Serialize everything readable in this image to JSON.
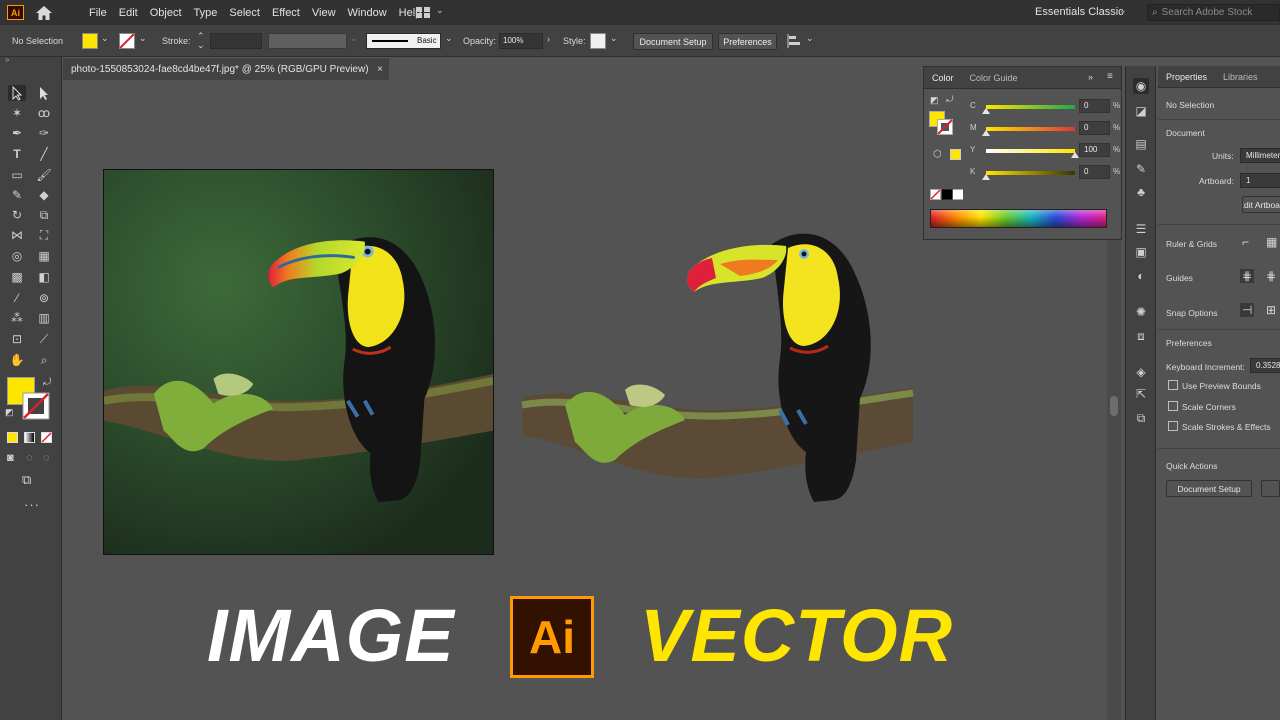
{
  "app": {
    "logo": "Ai"
  },
  "menu": [
    "File",
    "Edit",
    "Object",
    "Type",
    "Select",
    "Effect",
    "View",
    "Window",
    "Help"
  ],
  "workspace": "Essentials Classic",
  "search": {
    "placeholder": "Search Adobe Stock"
  },
  "controlbar": {
    "selection": "No Selection",
    "stroke_label": "Stroke:",
    "brush": "Basic",
    "opacity_label": "Opacity:",
    "opacity_value": "100%",
    "style_label": "Style:",
    "document_setup": "Document Setup",
    "preferences": "Preferences"
  },
  "document_tab": {
    "title": "photo-1550853024-fae8cd4be47f.jpg* @ 25% (RGB/GPU Preview)",
    "close": "×"
  },
  "artboard": {
    "left_word": "IMAGE",
    "right_word": "VECTOR",
    "badge": "Ai"
  },
  "color_panel": {
    "tabs": [
      "Color",
      "Color Guide"
    ],
    "channels": [
      {
        "label": "C",
        "value": "0",
        "fraction": 0.0
      },
      {
        "label": "M",
        "value": "0",
        "fraction": 0.0
      },
      {
        "label": "Y",
        "value": "100",
        "fraction": 1.0
      },
      {
        "label": "K",
        "value": "0",
        "fraction": 0.0
      }
    ],
    "percent": "%"
  },
  "properties": {
    "tabs": [
      "Properties",
      "Libraries"
    ],
    "selection": "No Selection",
    "document_header": "Document",
    "units_label": "Units:",
    "units_value": "Millimeters",
    "artboard_label": "Artboard:",
    "artboard_value": "1",
    "edit_artboards": "Edit Artboards",
    "ruler_grids": "Ruler & Grids",
    "guides": "Guides",
    "snap_options": "Snap Options",
    "preferences_header": "Preferences",
    "keyboard_increment_label": "Keyboard Increment:",
    "keyboard_increment_value": "0.3528",
    "use_preview_bounds": "Use Preview Bounds",
    "scale_corners": "Scale Corners",
    "scale_strokes": "Scale Strokes & Effects",
    "quick_actions": "Quick Actions",
    "document_setup": "Document Setup"
  },
  "colors": {
    "fill": "#ffe600",
    "accent": "#ff9a00"
  }
}
